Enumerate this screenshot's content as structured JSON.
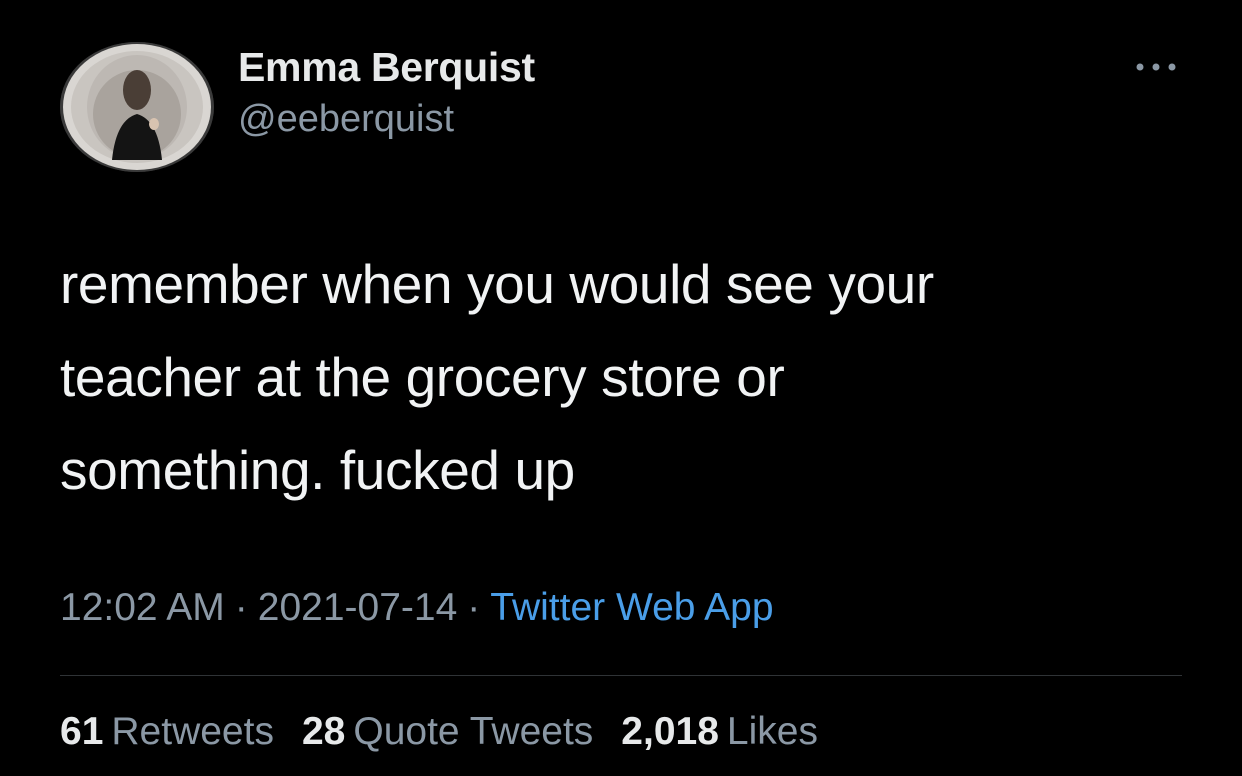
{
  "user": {
    "display_name": "Emma Berquist",
    "handle": "@eeberquist"
  },
  "tweet": {
    "lines": [
      "remember when you would see your",
      "teacher at the grocery store or",
      "something. fucked up"
    ],
    "time": "12:02 AM",
    "date": "2021-07-14",
    "separator": "·",
    "source": "Twitter Web App"
  },
  "stats": {
    "retweets_count": "61",
    "retweets_label": "Retweets",
    "quotes_count": "28",
    "quotes_label": "Quote Tweets",
    "likes_count": "2,018",
    "likes_label": "Likes"
  },
  "colors": {
    "background": "#000000",
    "text_primary": "#e7e9ea",
    "text_secondary": "#8b98a5",
    "link": "#4a9ee8",
    "divider": "#2f3336"
  },
  "icons": {
    "more": "more-horizontal-icon"
  }
}
